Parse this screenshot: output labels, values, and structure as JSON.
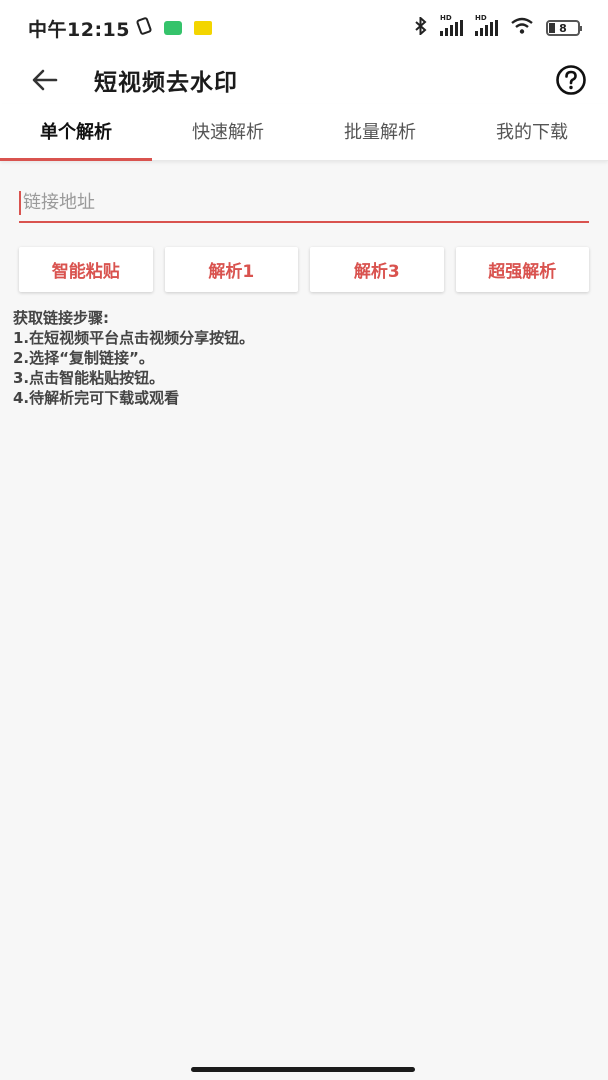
{
  "status_bar": {
    "time": "中午12:15",
    "battery": "8",
    "hd_label": "HD"
  },
  "app_bar": {
    "title": "短视频去水印",
    "back_icon": "arrow-left-icon",
    "help_icon": "question-circle-icon"
  },
  "tabs": [
    {
      "label": "单个解析",
      "active": true
    },
    {
      "label": "快速解析",
      "active": false
    },
    {
      "label": "批量解析",
      "active": false
    },
    {
      "label": "我的下载",
      "active": false
    }
  ],
  "input": {
    "placeholder": "链接地址",
    "value": ""
  },
  "buttons": [
    {
      "label": "智能粘贴"
    },
    {
      "label": "解析1"
    },
    {
      "label": "解析3"
    },
    {
      "label": "超强解析"
    }
  ],
  "instructions": {
    "heading": "获取链接步骤:",
    "steps": [
      "1.在短视频平台点击视频分享按钮。",
      "2.选择“复制链接”。",
      "3.点击智能粘贴按钮。",
      "4.待解析完可下载或观看"
    ]
  },
  "colors": {
    "accent": "#d9534f",
    "background": "#f7f7f7"
  }
}
